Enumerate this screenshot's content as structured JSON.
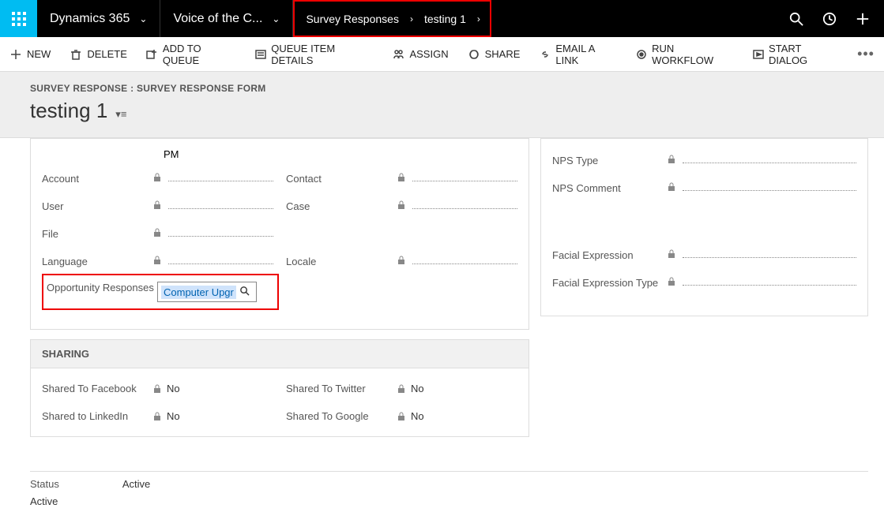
{
  "topbar": {
    "brand": "Dynamics 365",
    "area": "Voice of the C...",
    "breadcrumb": [
      "Survey Responses",
      "testing 1"
    ]
  },
  "commands": {
    "new": "NEW",
    "delete": "DELETE",
    "add_to_queue": "ADD TO QUEUE",
    "queue_item_details": "QUEUE ITEM DETAILS",
    "assign": "ASSIGN",
    "share": "SHARE",
    "email_a_link": "EMAIL A LINK",
    "run_workflow": "RUN WORKFLOW",
    "start_dialog": "START DIALOG"
  },
  "header": {
    "entity_path": "SURVEY RESPONSE : SURVEY RESPONSE FORM",
    "record_title": "testing 1"
  },
  "form": {
    "pm_label": "PM",
    "left_col": {
      "account": "Account",
      "user": "User",
      "file": "File",
      "language": "Language",
      "opportunity_responses": "Opportunity Responses"
    },
    "right_col": {
      "contact": "Contact",
      "case": "Case",
      "locale": "Locale"
    },
    "lookup_value": "Computer Upgr"
  },
  "right_panel": {
    "nps_type": "NPS Type",
    "nps_comment": "NPS Comment",
    "facial_expression": "Facial Expression",
    "facial_expression_type": "Facial Expression Type"
  },
  "sharing": {
    "header": "SHARING",
    "facebook_lbl": "Shared To Facebook",
    "facebook_val": "No",
    "linkedin_lbl": "Shared to LinkedIn",
    "linkedin_val": "No",
    "twitter_lbl": "Shared To Twitter",
    "twitter_val": "No",
    "google_lbl": "Shared To Google",
    "google_val": "No"
  },
  "footer": {
    "status_lbl": "Status",
    "status_val": "Active",
    "state": "Active"
  }
}
